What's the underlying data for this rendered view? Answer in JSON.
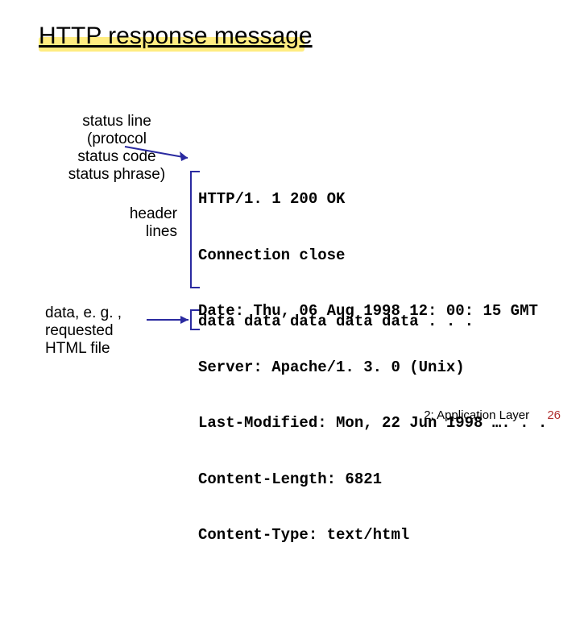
{
  "title": "HTTP response message",
  "labels": {
    "status": "status line\n(protocol\nstatus code\nstatus phrase)",
    "headers": "header\nlines",
    "data": "data, e. g. ,\nrequested\nHTML file"
  },
  "code": {
    "status_line": "HTTP/1. 1 200 OK",
    "headers": [
      "Connection close",
      "Date: Thu, 06 Aug 1998 12: 00: 15 GMT",
      "Server: Apache/1. 3. 0 (Unix)",
      "Last-Modified: Mon, 22 Jun 1998 …. . .",
      "Content-Length: 6821",
      "Content-Type: text/html"
    ],
    "blank": " ",
    "data_line": "data data data data data . . ."
  },
  "footer": {
    "chapter": "2: Application Layer",
    "page": "26"
  }
}
